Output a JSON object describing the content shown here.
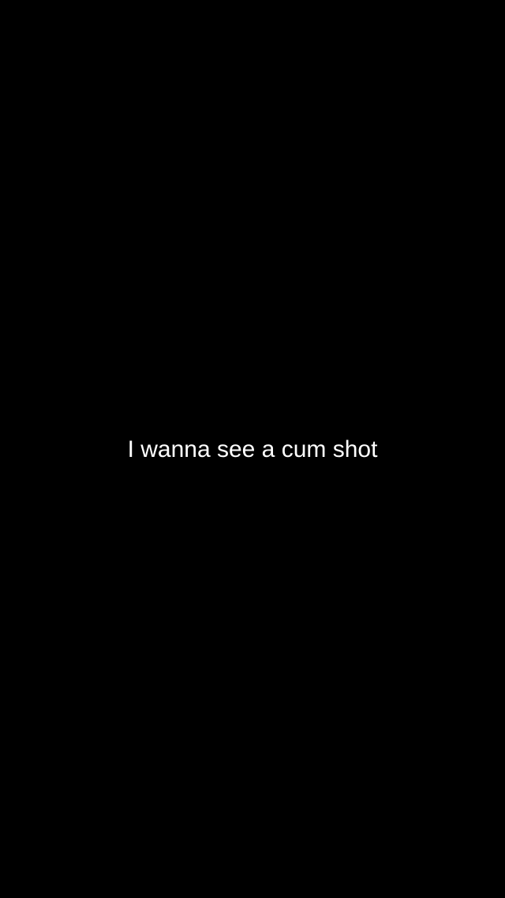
{
  "snap": {
    "caption": "I wanna see a cum shot"
  },
  "colors": {
    "background": "#000000",
    "caption_text": "#ffffff"
  }
}
